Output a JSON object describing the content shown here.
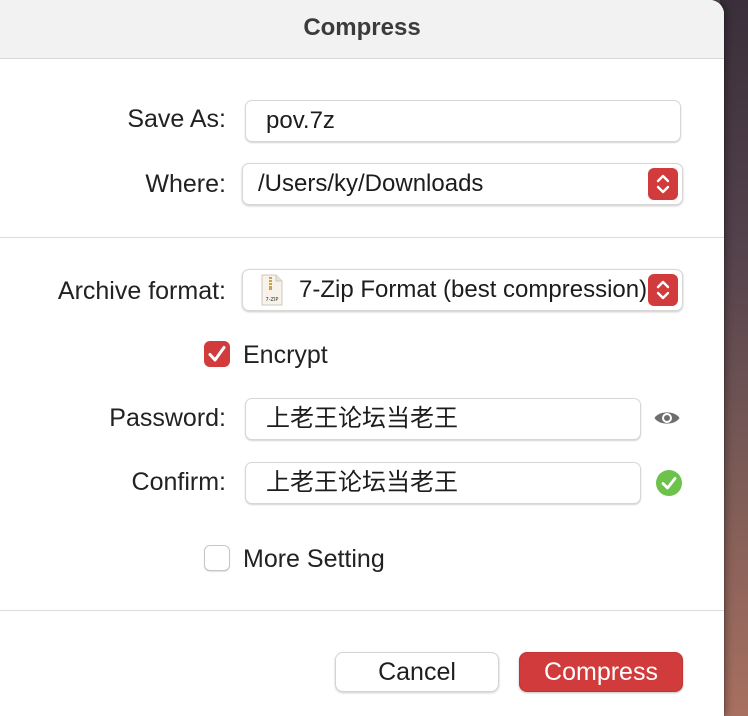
{
  "window": {
    "title": "Compress"
  },
  "form": {
    "save_as_label": "Save As:",
    "save_as_value": "pov.7z",
    "where_label": "Where:",
    "where_value": "/Users/ky/Downloads",
    "archive_format_label": "Archive format:",
    "archive_format_value": "7-Zip Format (best compression)",
    "archive_format_icon_text": "7-ZIP",
    "encrypt_label": "Encrypt",
    "encrypt_checked": true,
    "password_label": "Password:",
    "password_value": "上老王论坛当老王",
    "confirm_label": "Confirm:",
    "confirm_value": "上老王论坛当老王",
    "more_setting_label": "More Setting",
    "more_setting_checked": false
  },
  "buttons": {
    "cancel_label": "Cancel",
    "compress_label": "Compress"
  },
  "icons": {
    "where_stepper": "up-down-chevron-icon",
    "format_stepper": "up-down-chevron-icon",
    "archive_file": "7zip-file-icon",
    "show_password": "eye-icon",
    "match_status": "checkmark-circle-icon"
  },
  "colors": {
    "accent": "#d13b3b",
    "success": "#6cc24a",
    "icon_gray": "#6e6e6e"
  }
}
